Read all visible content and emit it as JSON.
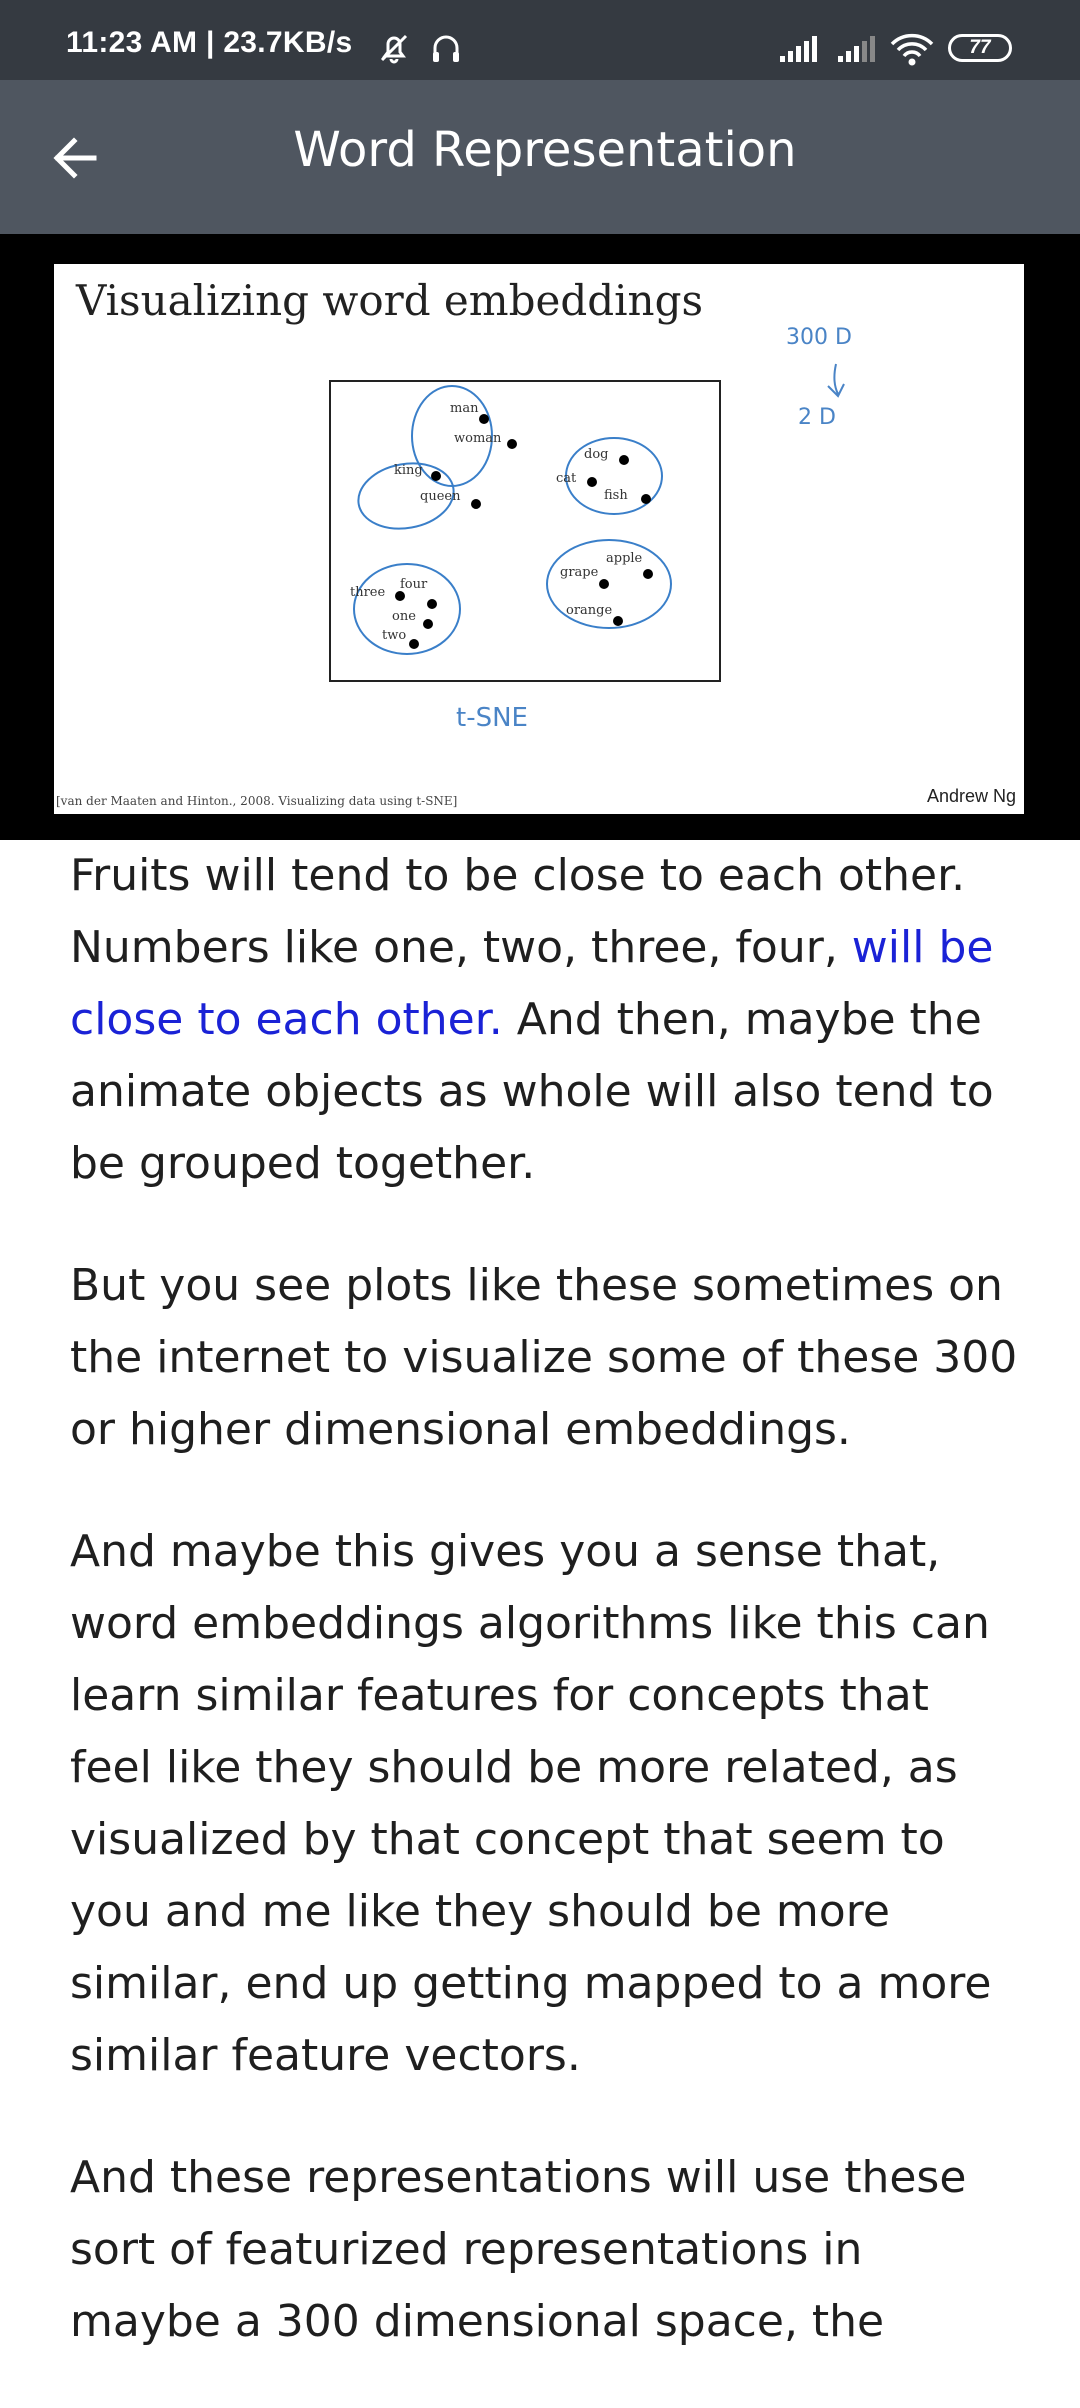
{
  "status_bar": {
    "time": "11:23 AM | 23.7KB/s",
    "battery": "77",
    "icons": [
      "mute-bell-icon",
      "headphones-icon",
      "signal-icon",
      "signal-icon",
      "wifi-icon",
      "battery-icon"
    ]
  },
  "app_bar": {
    "back_icon": "back-arrow-icon",
    "title": "Word Representation"
  },
  "slide": {
    "title": "Visualizing word embeddings",
    "citation": "[van der Maaten and Hinton., 2008. Visualizing data using t-SNE]",
    "author": "Andrew Ng",
    "annotation_top": "300 D",
    "annotation_bottom": "2 D",
    "annotation_method": "t-SNE",
    "clusters": [
      {
        "words": [
          "man",
          "woman",
          "king",
          "queen"
        ]
      },
      {
        "words": [
          "dog",
          "cat",
          "fish"
        ]
      },
      {
        "words": [
          "three",
          "four",
          "one",
          "two"
        ]
      },
      {
        "words": [
          "grape",
          "apple",
          "orange"
        ]
      }
    ]
  },
  "article": {
    "p1_part1": "Fruits will tend to be close to each other. Numbers like one, two, three, four, ",
    "p1_link": "will be close to each other.",
    "p1_part2": " And then, maybe the animate objects as whole will also tend to be grouped together.",
    "p2": "But you see plots like these sometimes on the internet to visualize some of these 300 or higher dimensional embeddings.",
    "p3": "And maybe this gives you a sense that, word embeddings algorithms like this can learn similar features for concepts that feel like they should be more related, as visualized by that concept that seem to you and me like they should be more similar, end up getting mapped to a more similar feature vectors.",
    "p4": "And these representations will use these sort of featurized representations in maybe a 300 dimensional space, the"
  }
}
